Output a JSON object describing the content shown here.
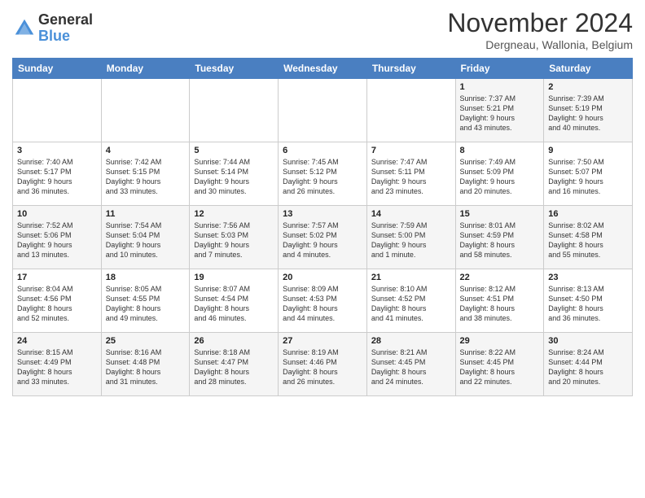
{
  "header": {
    "logo_general": "General",
    "logo_blue": "Blue",
    "month_title": "November 2024",
    "location": "Dergneau, Wallonia, Belgium"
  },
  "days_of_week": [
    "Sunday",
    "Monday",
    "Tuesday",
    "Wednesday",
    "Thursday",
    "Friday",
    "Saturday"
  ],
  "weeks": [
    [
      {
        "day": "",
        "info": ""
      },
      {
        "day": "",
        "info": ""
      },
      {
        "day": "",
        "info": ""
      },
      {
        "day": "",
        "info": ""
      },
      {
        "day": "",
        "info": ""
      },
      {
        "day": "1",
        "info": "Sunrise: 7:37 AM\nSunset: 5:21 PM\nDaylight: 9 hours\nand 43 minutes."
      },
      {
        "day": "2",
        "info": "Sunrise: 7:39 AM\nSunset: 5:19 PM\nDaylight: 9 hours\nand 40 minutes."
      }
    ],
    [
      {
        "day": "3",
        "info": "Sunrise: 7:40 AM\nSunset: 5:17 PM\nDaylight: 9 hours\nand 36 minutes."
      },
      {
        "day": "4",
        "info": "Sunrise: 7:42 AM\nSunset: 5:15 PM\nDaylight: 9 hours\nand 33 minutes."
      },
      {
        "day": "5",
        "info": "Sunrise: 7:44 AM\nSunset: 5:14 PM\nDaylight: 9 hours\nand 30 minutes."
      },
      {
        "day": "6",
        "info": "Sunrise: 7:45 AM\nSunset: 5:12 PM\nDaylight: 9 hours\nand 26 minutes."
      },
      {
        "day": "7",
        "info": "Sunrise: 7:47 AM\nSunset: 5:11 PM\nDaylight: 9 hours\nand 23 minutes."
      },
      {
        "day": "8",
        "info": "Sunrise: 7:49 AM\nSunset: 5:09 PM\nDaylight: 9 hours\nand 20 minutes."
      },
      {
        "day": "9",
        "info": "Sunrise: 7:50 AM\nSunset: 5:07 PM\nDaylight: 9 hours\nand 16 minutes."
      }
    ],
    [
      {
        "day": "10",
        "info": "Sunrise: 7:52 AM\nSunset: 5:06 PM\nDaylight: 9 hours\nand 13 minutes."
      },
      {
        "day": "11",
        "info": "Sunrise: 7:54 AM\nSunset: 5:04 PM\nDaylight: 9 hours\nand 10 minutes."
      },
      {
        "day": "12",
        "info": "Sunrise: 7:56 AM\nSunset: 5:03 PM\nDaylight: 9 hours\nand 7 minutes."
      },
      {
        "day": "13",
        "info": "Sunrise: 7:57 AM\nSunset: 5:02 PM\nDaylight: 9 hours\nand 4 minutes."
      },
      {
        "day": "14",
        "info": "Sunrise: 7:59 AM\nSunset: 5:00 PM\nDaylight: 9 hours\nand 1 minute."
      },
      {
        "day": "15",
        "info": "Sunrise: 8:01 AM\nSunset: 4:59 PM\nDaylight: 8 hours\nand 58 minutes."
      },
      {
        "day": "16",
        "info": "Sunrise: 8:02 AM\nSunset: 4:58 PM\nDaylight: 8 hours\nand 55 minutes."
      }
    ],
    [
      {
        "day": "17",
        "info": "Sunrise: 8:04 AM\nSunset: 4:56 PM\nDaylight: 8 hours\nand 52 minutes."
      },
      {
        "day": "18",
        "info": "Sunrise: 8:05 AM\nSunset: 4:55 PM\nDaylight: 8 hours\nand 49 minutes."
      },
      {
        "day": "19",
        "info": "Sunrise: 8:07 AM\nSunset: 4:54 PM\nDaylight: 8 hours\nand 46 minutes."
      },
      {
        "day": "20",
        "info": "Sunrise: 8:09 AM\nSunset: 4:53 PM\nDaylight: 8 hours\nand 44 minutes."
      },
      {
        "day": "21",
        "info": "Sunrise: 8:10 AM\nSunset: 4:52 PM\nDaylight: 8 hours\nand 41 minutes."
      },
      {
        "day": "22",
        "info": "Sunrise: 8:12 AM\nSunset: 4:51 PM\nDaylight: 8 hours\nand 38 minutes."
      },
      {
        "day": "23",
        "info": "Sunrise: 8:13 AM\nSunset: 4:50 PM\nDaylight: 8 hours\nand 36 minutes."
      }
    ],
    [
      {
        "day": "24",
        "info": "Sunrise: 8:15 AM\nSunset: 4:49 PM\nDaylight: 8 hours\nand 33 minutes."
      },
      {
        "day": "25",
        "info": "Sunrise: 8:16 AM\nSunset: 4:48 PM\nDaylight: 8 hours\nand 31 minutes."
      },
      {
        "day": "26",
        "info": "Sunrise: 8:18 AM\nSunset: 4:47 PM\nDaylight: 8 hours\nand 28 minutes."
      },
      {
        "day": "27",
        "info": "Sunrise: 8:19 AM\nSunset: 4:46 PM\nDaylight: 8 hours\nand 26 minutes."
      },
      {
        "day": "28",
        "info": "Sunrise: 8:21 AM\nSunset: 4:45 PM\nDaylight: 8 hours\nand 24 minutes."
      },
      {
        "day": "29",
        "info": "Sunrise: 8:22 AM\nSunset: 4:45 PM\nDaylight: 8 hours\nand 22 minutes."
      },
      {
        "day": "30",
        "info": "Sunrise: 8:24 AM\nSunset: 4:44 PM\nDaylight: 8 hours\nand 20 minutes."
      }
    ]
  ]
}
